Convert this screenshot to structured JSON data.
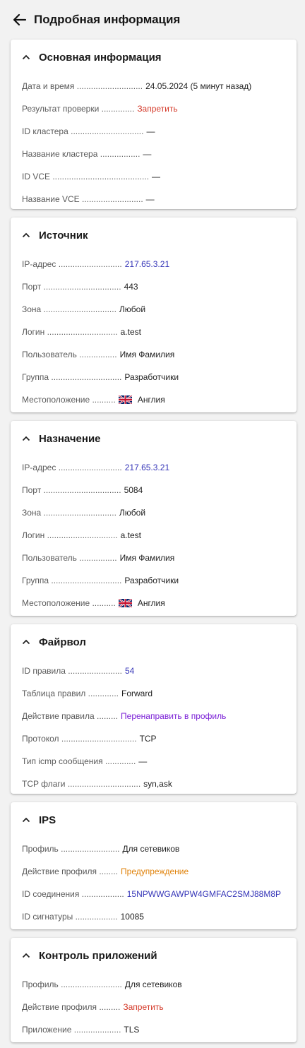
{
  "header": {
    "title": "Подробная информация"
  },
  "sections": {
    "main": {
      "title": "Основная информация",
      "rows": [
        {
          "label": "Дата и время ............................",
          "value": "24.05.2024 (5 минут назад)"
        },
        {
          "label": "Результат проверки ..............",
          "value": "Запретить"
        },
        {
          "label": "ID кластера ...............................",
          "value": "—"
        },
        {
          "label": "Название кластера .................",
          "value": "—"
        },
        {
          "label": "ID VCE .........................................",
          "value": "—"
        },
        {
          "label": "Название VCE ..........................",
          "value": "—"
        }
      ]
    },
    "source": {
      "title": "Источник",
      "rows": [
        {
          "label": "IP-адрес ...........................",
          "value": "217.65.3.21"
        },
        {
          "label": "Порт .................................",
          "value": "443"
        },
        {
          "label": "Зона ...............................",
          "value": "Любой"
        },
        {
          "label": "Логин ..............................",
          "value": "a.test"
        },
        {
          "label": "Пользователь ................",
          "value": "Имя Фамилия"
        },
        {
          "label": "Группа ..............................",
          "value": "Разработчики"
        },
        {
          "label": "Местоположение ..........",
          "value": "Англия"
        }
      ]
    },
    "destination": {
      "title": "Назначение",
      "rows": [
        {
          "label": "IP-адрес ...........................",
          "value": "217.65.3.21"
        },
        {
          "label": "Порт .................................",
          "value": "5084"
        },
        {
          "label": "Зона ...............................",
          "value": "Любой"
        },
        {
          "label": "Логин ..............................",
          "value": "a.test"
        },
        {
          "label": "Пользователь ................",
          "value": "Имя Фамилия"
        },
        {
          "label": "Группа ..............................",
          "value": "Разработчики"
        },
        {
          "label": "Местоположение ..........",
          "value": "Англия"
        }
      ]
    },
    "firewall": {
      "title": "Файрвол",
      "rows": [
        {
          "label": "ID правила .......................",
          "value": "54"
        },
        {
          "label": "Таблица правил .............",
          "value": "Forward"
        },
        {
          "label": "Действие правила .........",
          "value": "Перенаправить в профиль"
        },
        {
          "label": "Протокол ................................",
          "value": "TCP"
        },
        {
          "label": "Тип icmp сообщения .............",
          "value": "—"
        },
        {
          "label": "TCP флаги ...............................",
          "value": "syn,ask"
        }
      ]
    },
    "ips": {
      "title": "IPS",
      "rows": [
        {
          "label": "Профиль .........................",
          "value": "Для сетевиков"
        },
        {
          "label": "Действие профиля ........",
          "value": "Предупреждение"
        },
        {
          "label": "ID соединения ..................",
          "value": "15NPWWGAWPW4GMFAC2SMJ88M8P"
        },
        {
          "label": "ID сигнатуры ..................",
          "value": "10085"
        }
      ]
    },
    "app_control": {
      "title": "Контроль приложений",
      "rows": [
        {
          "label": "Профиль ..........................",
          "value": "Для сетевиков"
        },
        {
          "label": "Действие профиля .........",
          "value": "Запретить"
        },
        {
          "label": "Приложение ....................",
          "value": "TLS"
        }
      ]
    }
  },
  "colors": {
    "link": "#3636b8",
    "danger": "#d43a2a",
    "warning": "#e0820a",
    "purple": "#7a1fd6"
  },
  "icons": {
    "back": "arrow-left-icon",
    "collapse": "chevron-up-icon",
    "flag": "uk-flag-icon"
  }
}
